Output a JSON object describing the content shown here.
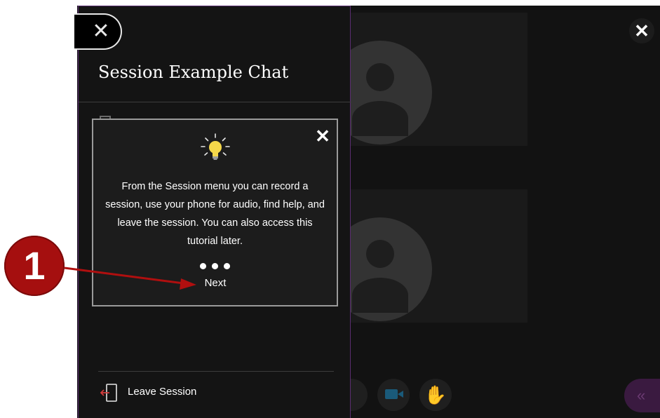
{
  "panel": {
    "title": "Session Example Chat",
    "close_icon": "close-icon",
    "leave_label": "Leave Session",
    "leave_icon": "leave-session-icon"
  },
  "tip": {
    "icon": "lightbulb-icon",
    "close_icon": "close-icon",
    "body": "From the Session menu you can record a session, use your phone for audio, find help, and leave the session. You can also access this tutorial later.",
    "next_label": "Next",
    "progress_dots": 3
  },
  "callout": {
    "number": "1"
  },
  "window": {
    "close_icon": "close-icon"
  },
  "colors": {
    "panel_bg": "#141414",
    "panel_border": "#5a2d70",
    "callout_red": "#a50f0f",
    "bulb_yellow": "#f5d84a",
    "leave_icon_red": "#d23c3c"
  }
}
